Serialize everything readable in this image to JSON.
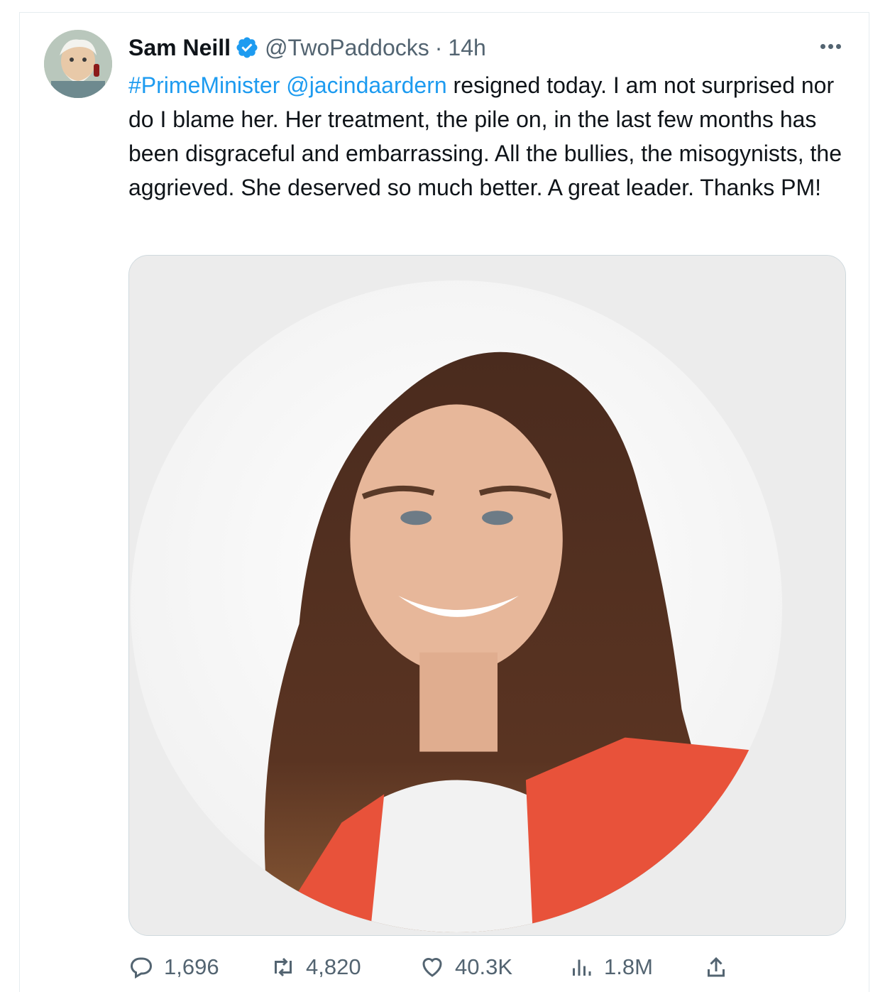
{
  "tweet": {
    "author_name": "Sam Neill",
    "handle": "@TwoPaddocks",
    "separator": "·",
    "time": "14h",
    "hashtag": "#PrimeMinister",
    "mention": "@jacindaardern",
    "body": " resigned today. I am not surprised nor do I blame her. Her treatment, the pile on, in the last few months has been disgraceful and embarrassing. All the bullies, the misogynists, the aggrieved. She deserved so much better. A great leader. Thanks PM!"
  },
  "metrics": {
    "replies": "1,696",
    "retweets": "4,820",
    "likes": "40.3K",
    "views": "1.8M"
  },
  "icons": {
    "verified": "verified-badge-icon",
    "more": "more-options-icon",
    "reply": "reply-icon",
    "retweet": "retweet-icon",
    "like": "heart-icon",
    "views": "views-icon",
    "share": "share-icon"
  },
  "colors": {
    "link": "#1d9bf0",
    "secondary_text": "#536471",
    "primary_text": "#0f1419",
    "border": "#cfd9de"
  }
}
